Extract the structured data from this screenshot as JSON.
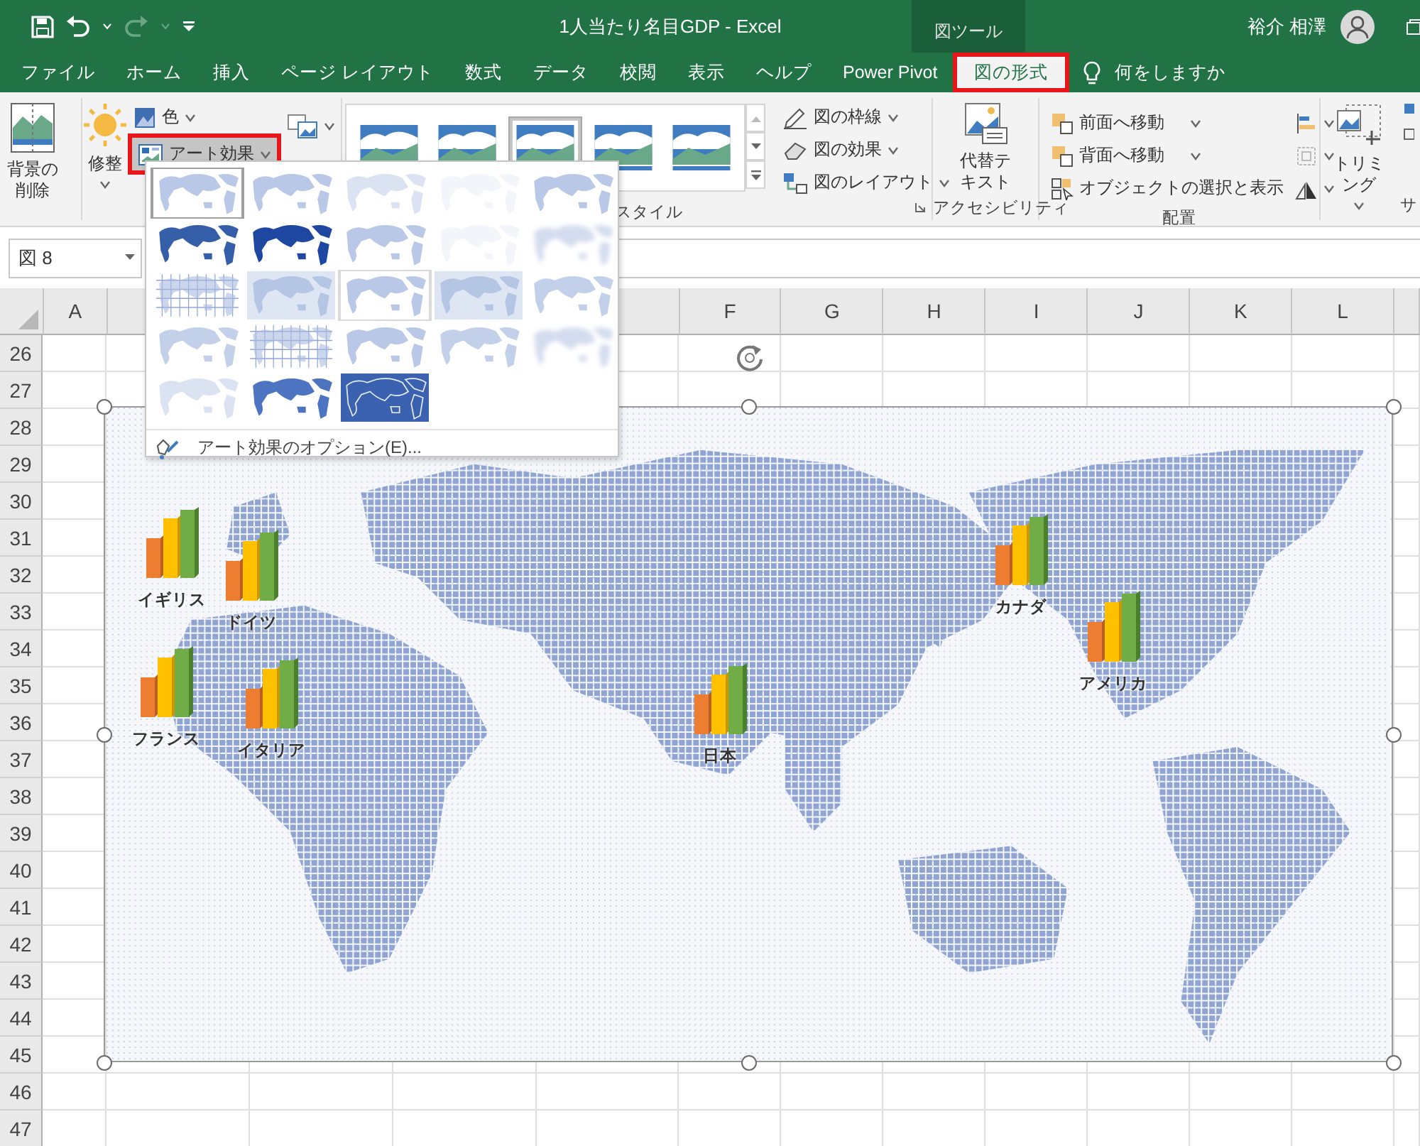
{
  "title_bar": {
    "title": "1人当たり名目GDP - Excel",
    "context": "図ツール",
    "user": "裕介 相澤"
  },
  "tabs": [
    {
      "label": "ファイル",
      "selected": false,
      "highlighted": false
    },
    {
      "label": "ホーム",
      "selected": false,
      "highlighted": false
    },
    {
      "label": "挿入",
      "selected": false,
      "highlighted": false
    },
    {
      "label": "ページ レイアウト",
      "selected": false,
      "highlighted": false
    },
    {
      "label": "数式",
      "selected": false,
      "highlighted": false
    },
    {
      "label": "データ",
      "selected": false,
      "highlighted": false
    },
    {
      "label": "校閲",
      "selected": false,
      "highlighted": false
    },
    {
      "label": "表示",
      "selected": false,
      "highlighted": false
    },
    {
      "label": "ヘルプ",
      "selected": false,
      "highlighted": false
    },
    {
      "label": "Power Pivot",
      "selected": false,
      "highlighted": false
    },
    {
      "label": "図の形式",
      "selected": true,
      "highlighted": true
    }
  ],
  "search": {
    "placeholder": "何をしますか"
  },
  "ribbon": {
    "remove_background": "背景の削除",
    "corrections": "修整",
    "color_label": "色",
    "art_effects": {
      "label": "アート効果",
      "pressed": true,
      "highlighted": true
    },
    "styles": {
      "thumbnails": [
        {
          "selected": false
        },
        {
          "selected": false
        },
        {
          "selected": true
        },
        {
          "selected": false
        },
        {
          "selected": false
        }
      ],
      "label": "スタイル"
    },
    "style_commands": [
      "図の枠線",
      "図の効果",
      "図のレイアウト"
    ],
    "alt_text": "代替テキスト",
    "accessibility_label": "アクセシビリティ",
    "arrange_commands": [
      "前面へ移動",
      "背面へ移動",
      "オブジェクトの選択と表示"
    ],
    "arrange_label": "配置",
    "crop": "トリミング",
    "size_label": "サ"
  },
  "name_box": {
    "value": "図 8"
  },
  "columns": [
    "A",
    "F",
    "G",
    "H",
    "I",
    "J",
    "K",
    "L"
  ],
  "rows": [
    "26",
    "27",
    "28",
    "29",
    "30",
    "31",
    "32",
    "33",
    "34",
    "35",
    "36",
    "37",
    "38",
    "39",
    "40",
    "41",
    "42",
    "43",
    "44",
    "45",
    "46",
    "47"
  ],
  "map": {
    "kind": "picture",
    "markers": [
      {
        "label": "イギリス"
      },
      {
        "label": "ドイツ"
      },
      {
        "label": "フランス"
      },
      {
        "label": "イタリア"
      },
      {
        "label": "日本"
      },
      {
        "label": "カナダ"
      },
      {
        "label": "アメリカ"
      }
    ]
  },
  "art_effects_menu": {
    "items": [
      {
        "kind": "faint",
        "selected": true,
        "hovered": false
      },
      {
        "kind": "faint",
        "selected": false,
        "hovered": false
      },
      {
        "kind": "pale",
        "selected": false,
        "hovered": false
      },
      {
        "kind": "blank",
        "selected": false,
        "hovered": false
      },
      {
        "kind": "faint",
        "selected": false,
        "hovered": false
      },
      {
        "kind": "dark",
        "selected": false,
        "hovered": false
      },
      {
        "kind": "solid",
        "selected": false,
        "hovered": false
      },
      {
        "kind": "faint",
        "selected": false,
        "hovered": false
      },
      {
        "kind": "blank",
        "selected": false,
        "hovered": false
      },
      {
        "kind": "blur",
        "selected": false,
        "hovered": false
      },
      {
        "kind": "grid",
        "selected": false,
        "hovered": false
      },
      {
        "kind": "tint",
        "selected": false,
        "hovered": false
      },
      {
        "kind": "faint",
        "selected": false,
        "hovered": true
      },
      {
        "kind": "tint",
        "selected": false,
        "hovered": false
      },
      {
        "kind": "speckle",
        "selected": false,
        "hovered": false
      },
      {
        "kind": "speckle",
        "selected": false,
        "hovered": false
      },
      {
        "kind": "grid",
        "selected": false,
        "hovered": false
      },
      {
        "kind": "faint",
        "selected": false,
        "hovered": false
      },
      {
        "kind": "speckle",
        "selected": false,
        "hovered": false
      },
      {
        "kind": "blur",
        "selected": false,
        "hovered": false
      },
      {
        "kind": "pale",
        "selected": false,
        "hovered": false
      },
      {
        "kind": "medium",
        "selected": false,
        "hovered": false
      },
      {
        "kind": "inverse",
        "selected": false,
        "hovered": false
      }
    ],
    "options": "アート効果のオプション(E)..."
  }
}
